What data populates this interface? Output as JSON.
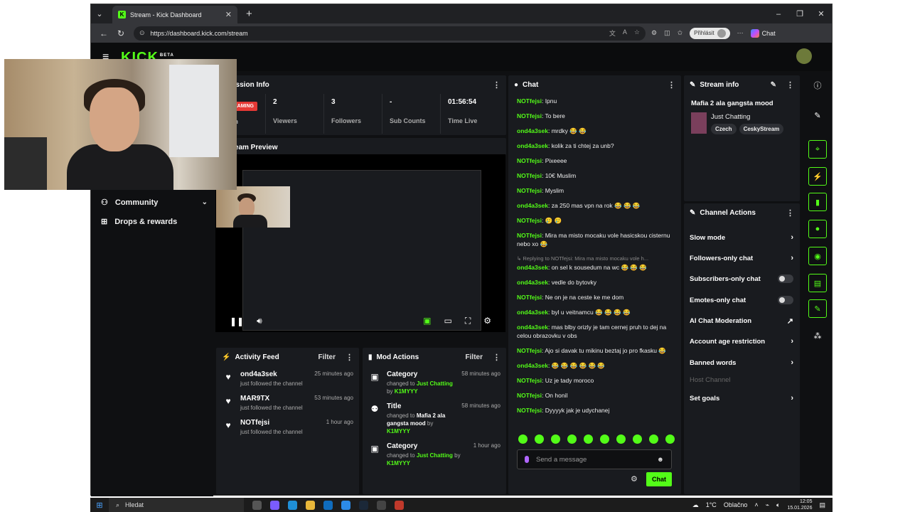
{
  "browser": {
    "tab_title": "Stream - Kick Dashboard",
    "url": "https://dashboard.kick.com/stream",
    "login_label": "Přihlásit",
    "chat_label": "Chat"
  },
  "header": {
    "logo": "KICK",
    "logo_badge": "BETA"
  },
  "nav": {
    "items": [
      {
        "label": "Community",
        "icon": "community-icon"
      },
      {
        "label": "Drops & rewards",
        "icon": "gift-icon"
      }
    ]
  },
  "session": {
    "title": "ession Info",
    "status": "EAMING",
    "status_sub": "on",
    "stats": [
      {
        "value": "2",
        "label": "Viewers"
      },
      {
        "value": "3",
        "label": "Followers"
      },
      {
        "value": "-",
        "label": "Sub Counts"
      },
      {
        "value": "01:56:54",
        "label": "Time Live"
      }
    ]
  },
  "preview": {
    "title": "ream Preview"
  },
  "activity": {
    "title": "Activity Feed",
    "filter": "Filter",
    "items": [
      {
        "name": "ond4a3sek",
        "sub": "just followed the channel",
        "time": "25 minutes ago"
      },
      {
        "name": "MAR9TX",
        "sub": "just followed the channel",
        "time": "53 minutes ago"
      },
      {
        "name": "NOTfejsi",
        "sub": "just followed the channel",
        "time": "1 hour ago"
      }
    ]
  },
  "mod": {
    "title": "Mod Actions",
    "filter": "Filter",
    "items": [
      {
        "name": "Category",
        "pre": "changed to",
        "value": "Just Chatting",
        "by": "by",
        "user": "K1MYYY",
        "time": "58 minutes ago"
      },
      {
        "name": "Title",
        "pre": "changed to",
        "value": "Mafia 2 ala gangsta mood",
        "by": "by",
        "user": "K1MYYY",
        "time": "58 minutes ago"
      },
      {
        "name": "Category",
        "pre": "changed to",
        "value": "Just Chatting",
        "by": "by",
        "user": "K1MYYY",
        "time": "1 hour ago"
      }
    ]
  },
  "chat": {
    "title": "Chat",
    "messages": [
      {
        "user": "NOTfejsi",
        "text": "Ipnu"
      },
      {
        "user": "NOTfejsi",
        "text": "To bere"
      },
      {
        "user": "ond4a3sek",
        "text": "mrdky 😂 😂"
      },
      {
        "user": "ond4a3sek",
        "text": "kolik za ti chtej za unb?"
      },
      {
        "user": "NOTfejsi",
        "text": "Pixeeee"
      },
      {
        "user": "NOTfejsi",
        "text": "10€ Muslim"
      },
      {
        "user": "NOTfejsi",
        "text": "Myslim"
      },
      {
        "user": "ond4a3sek",
        "text": "za 250 mas vpn na rok 😂 😂 😂"
      },
      {
        "user": "NOTfejsi",
        "text": "🥲 🥲"
      },
      {
        "user": "NOTfejsi",
        "text": "Mira ma misto mocaku vole hasicskou cisternu nebo xo 😂"
      },
      {
        "reply": "↳ Replying to NOTfejsi: Mira ma misto mocaku vole h...",
        "user": "ond4a3sek",
        "text": "on sel k sousedum na wc 😂 😂 😂"
      },
      {
        "user": "ond4a3sek",
        "text": "vedle do bytovky"
      },
      {
        "user": "NOTfejsi",
        "text": "Ne on je na ceste ke me dom"
      },
      {
        "user": "ond4a3sek",
        "text": "byl u veitnamcu 😂 😂 😂 😂"
      },
      {
        "user": "ond4a3sek",
        "text": "mas blby orizly je tam cernej pruh to dej na celou obrazovku v obs"
      },
      {
        "user": "NOTfejsi",
        "text": "Ajo si davak tu mikinu beztaj jo pro fkasku 😂"
      },
      {
        "user": "ond4a3sek",
        "text": "😂 😂 😂 😂 😂 😂"
      },
      {
        "user": "NOTfejsi",
        "text": "Uz je tady moroco"
      },
      {
        "user": "NOTfejsi",
        "text": "On honil"
      },
      {
        "user": "NOTfejsi",
        "text": "Dyyyyk jak je udychanej"
      }
    ],
    "placeholder": "Send a message",
    "send_label": "Chat"
  },
  "stream_info": {
    "title": "Stream info",
    "stream_title": "Mafia 2 ala gangsta mood",
    "category": "Just Chatting",
    "tags": [
      "Czech",
      "CeskyStream"
    ]
  },
  "channel_actions": {
    "title": "Channel Actions",
    "items": [
      {
        "label": "Slow mode",
        "control": "chevron"
      },
      {
        "label": "Followers-only chat",
        "control": "chevron"
      },
      {
        "label": "Subscribers-only chat",
        "control": "toggle"
      },
      {
        "label": "Emotes-only chat",
        "control": "toggle"
      },
      {
        "label": "AI Chat Moderation",
        "control": "external"
      },
      {
        "label": "Account age restriction",
        "control": "chevron"
      },
      {
        "label": "Banned words",
        "control": "chevron"
      },
      {
        "label": "Host Channel",
        "control": "disabled"
      },
      {
        "label": "Set goals",
        "control": "chevron"
      }
    ]
  },
  "taskbar": {
    "search": "Hledat",
    "weather_temp": "1°C",
    "weather_desc": "Oblačno",
    "time": "12:05",
    "date": "15.01.2026"
  },
  "colors": {
    "accent": "#53fc18",
    "live": "#e53935",
    "bg": "#0f1012",
    "panel": "#191b1f"
  }
}
